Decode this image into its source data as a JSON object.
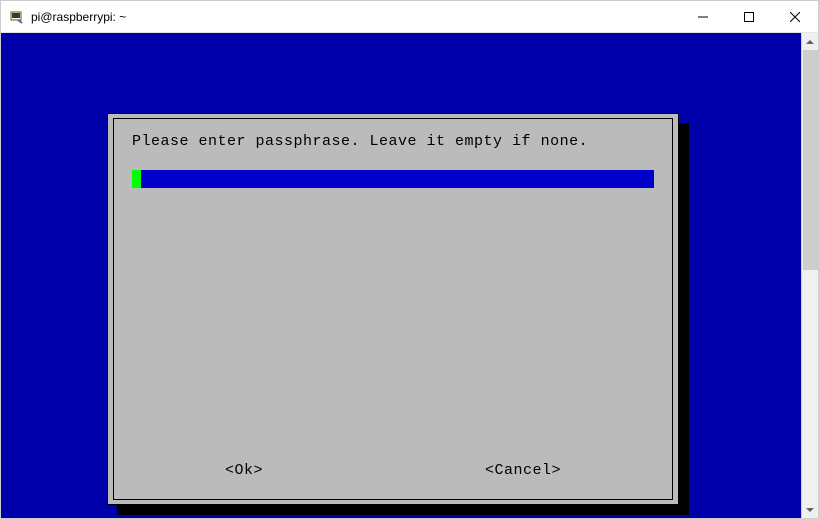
{
  "window": {
    "title": "pi@raspberrypi: ~"
  },
  "dialog": {
    "prompt": "Please enter passphrase. Leave it empty if none.",
    "input_value": "",
    "ok_label": "<Ok>",
    "cancel_label": "<Cancel>"
  },
  "colors": {
    "terminal_bg": "#0000aa",
    "dialog_bg": "#bbbbbb",
    "input_bg": "#0000cc",
    "cursor": "#00ff00"
  }
}
